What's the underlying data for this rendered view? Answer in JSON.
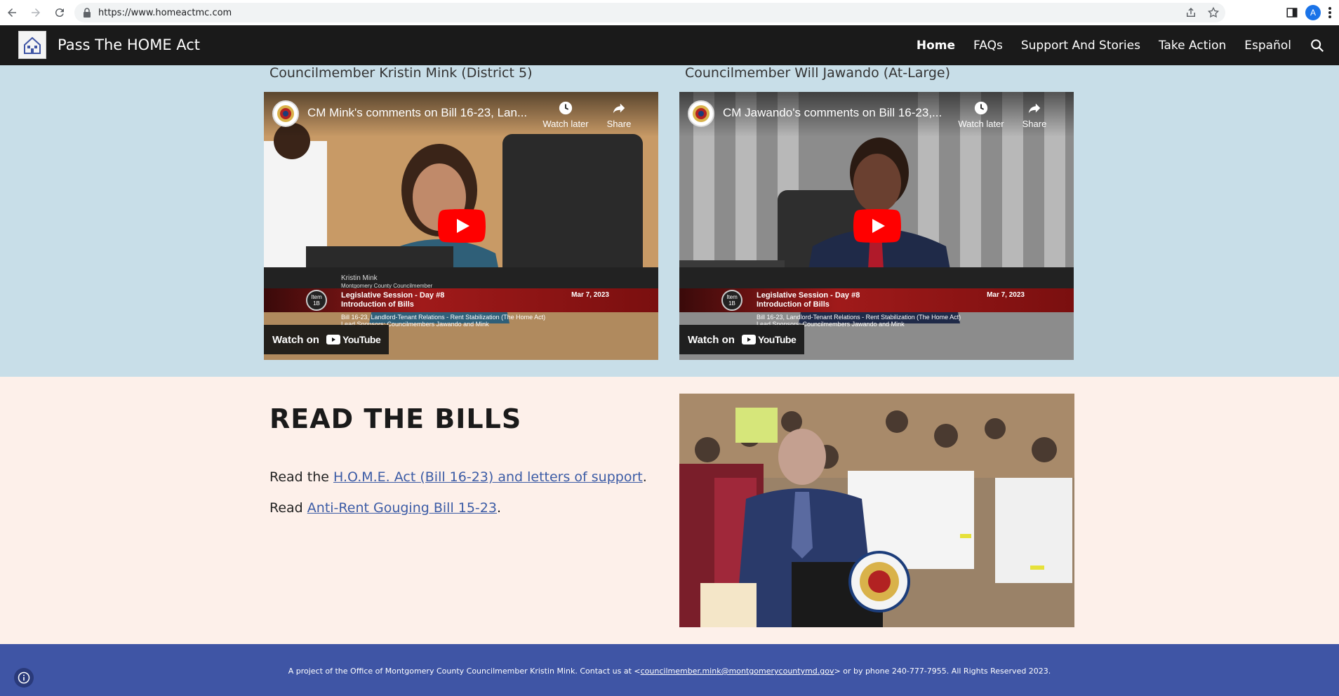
{
  "browser": {
    "url": "https://www.homeactmc.com",
    "profile_initial": "A"
  },
  "header": {
    "site_title": "Pass The HOME Act",
    "nav": [
      {
        "label": "Home",
        "active": true
      },
      {
        "label": "FAQs",
        "active": false
      },
      {
        "label": "Support And Stories",
        "active": false
      },
      {
        "label": "Take Action",
        "active": false
      },
      {
        "label": "Español",
        "active": false
      }
    ]
  },
  "videos": [
    {
      "caption": "Councilmember Kristin Mink (District 5)",
      "title": "CM Mink's comments on Bill 16-23, Lan...",
      "watch_later": "Watch later",
      "share": "Share",
      "speaker_name": "Kristin Mink",
      "speaker_role": "Montgomery County Councilmember",
      "item": "Item 1B",
      "session": "Legislative Session - Day #8",
      "session_sub": "Introduction of Bills",
      "date": "Mar 7, 2023",
      "bill_line1": "Bill 16-23, Landlord-Tenant Relations - Rent Stabilization (The Home Act)",
      "bill_line2": "Lead Sponsors: Councilmembers Jawando and Mink",
      "watch_on": "Watch on",
      "youtube": "YouTube"
    },
    {
      "caption": "Councilmember Will Jawando (At-Large)",
      "title": "CM Jawando's comments on Bill 16-23,...",
      "watch_later": "Watch later",
      "share": "Share",
      "item": "Item 1B",
      "session": "Legislative Session - Day #8",
      "session_sub": "Introduction of Bills",
      "date": "Mar 7, 2023",
      "bill_line1": "Bill 16-23, Landlord-Tenant Relations - Rent Stabilization (The Home Act)",
      "bill_line2": "Lead Sponsors: Councilmembers Jawando and Mink",
      "watch_on": "Watch on",
      "youtube": "YouTube"
    }
  ],
  "bills": {
    "heading": "READ THE BILLS",
    "line1_prefix": "Read the ",
    "line1_link": "H.O.M.E. Act (Bill 16-23) and letters of support",
    "line1_suffix": ".",
    "line2_prefix": "Read ",
    "line2_link": "Anti-Rent Gouging Bill 15-23",
    "line2_suffix": "."
  },
  "footer": {
    "text_prefix": "A project of the Office of Montgomery County Councilmember Kristin Mink.  Contact us at <",
    "email": "councilmember.mink@montgomerycountymd.gov",
    "text_suffix": "> or by phone 240-777-7955. All Rights Reserved 2023."
  },
  "colors": {
    "header_bg": "#1a1a1a",
    "video_section_bg": "#c8dee8",
    "bills_section_bg": "#fdf0ea",
    "footer_bg": "#3f55a5",
    "link": "#3b5ba5",
    "youtube_red": "#ff0000"
  }
}
